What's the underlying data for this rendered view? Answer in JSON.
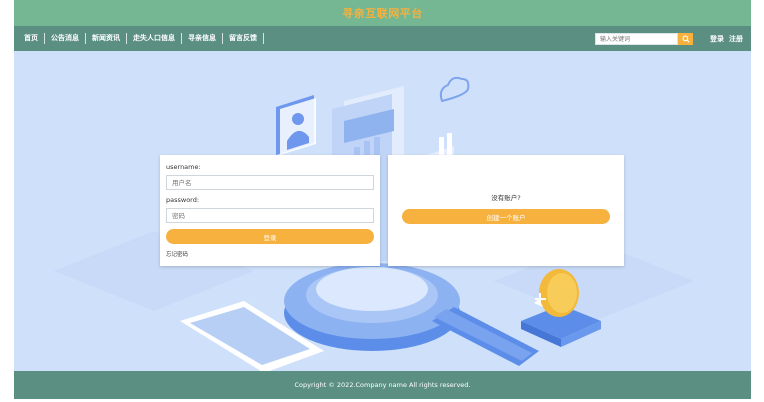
{
  "site": {
    "title": "寻亲互联网平台"
  },
  "nav": {
    "items": [
      {
        "label": "首页"
      },
      {
        "label": "公告消息"
      },
      {
        "label": "新闻资讯"
      },
      {
        "label": "走失人口信息"
      },
      {
        "label": "寻亲信息"
      },
      {
        "label": "留言反馈"
      }
    ]
  },
  "search": {
    "placeholder": "输入关键词",
    "icon": "search-icon"
  },
  "auth": {
    "login_label": "登录",
    "register_label": "注册"
  },
  "login_form": {
    "username_label": "username:",
    "username_placeholder": "用户名",
    "password_label": "password:",
    "password_placeholder": "密码",
    "submit_label": "登录",
    "forgot_label": "忘记密码"
  },
  "register_panel": {
    "prompt": "没有账户?",
    "create_label": "创建一个账户"
  },
  "footer": {
    "copyright": "Copyright © 2022.Company name All rights reserved."
  },
  "colors": {
    "title_bar": "#74b792",
    "nav_bar": "#5b8f82",
    "accent": "#f6b13f",
    "hero_bg": "#cfe0fa"
  }
}
